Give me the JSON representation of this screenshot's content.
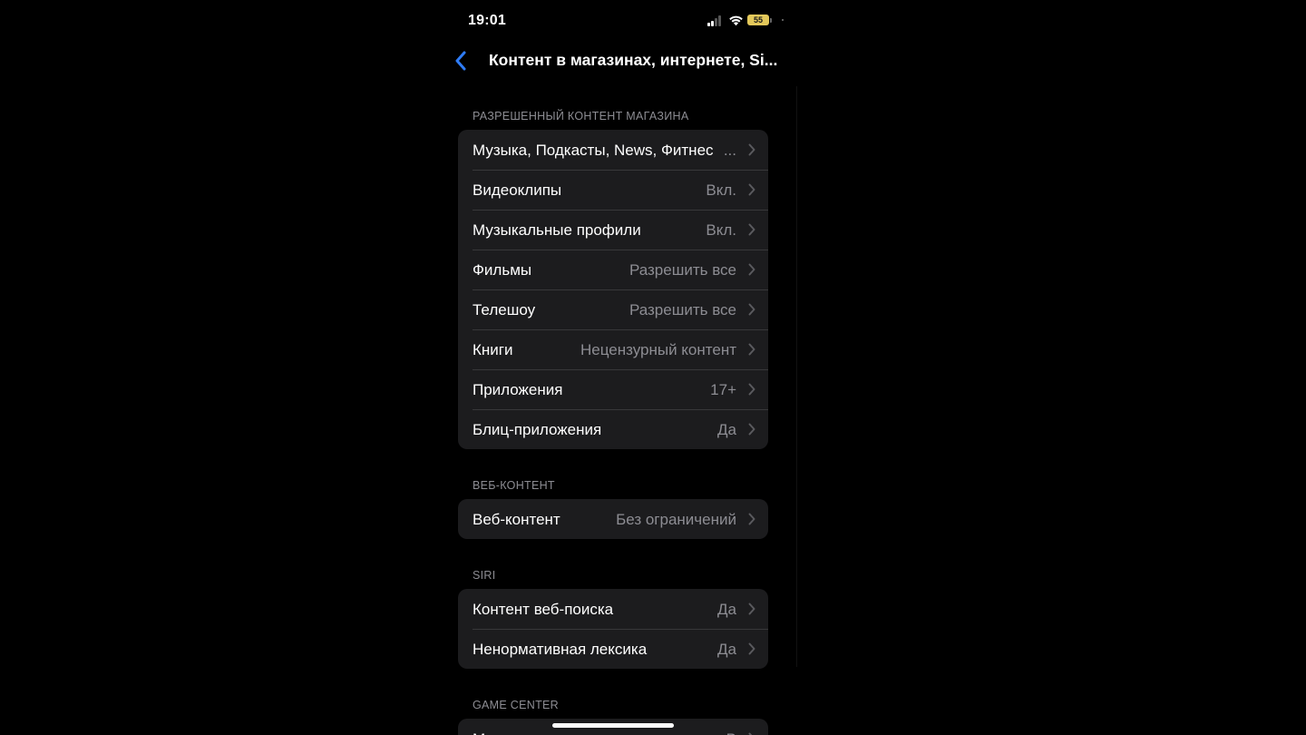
{
  "status_bar": {
    "time": "19:01",
    "battery": "55"
  },
  "nav": {
    "title": "Контент в магазинах, интернете, Si..."
  },
  "sections": [
    {
      "header": "РАЗРЕШЕННЫЙ КОНТЕНТ МАГАЗИНА",
      "rows": [
        {
          "label": "Музыка, Подкасты, News, Фитнес",
          "value": "..."
        },
        {
          "label": "Видеоклипы",
          "value": "Вкл."
        },
        {
          "label": "Музыкальные профили",
          "value": "Вкл."
        },
        {
          "label": "Фильмы",
          "value": "Разрешить все"
        },
        {
          "label": "Телешоу",
          "value": "Разрешить все"
        },
        {
          "label": "Книги",
          "value": "Нецензурный контент"
        },
        {
          "label": "Приложения",
          "value": "17+"
        },
        {
          "label": "Блиц-приложения",
          "value": "Да"
        }
      ]
    },
    {
      "header": "ВЕБ-КОНТЕНТ",
      "rows": [
        {
          "label": "Веб-контент",
          "value": "Без ограничений"
        }
      ]
    },
    {
      "header": "SIRI",
      "rows": [
        {
          "label": "Контент веб-поиска",
          "value": "Да"
        },
        {
          "label": "Ненормативная лексика",
          "value": "Да"
        }
      ]
    },
    {
      "header": "GAME CENTER",
      "rows": [
        {
          "label": "М",
          "value": "В"
        }
      ]
    }
  ]
}
